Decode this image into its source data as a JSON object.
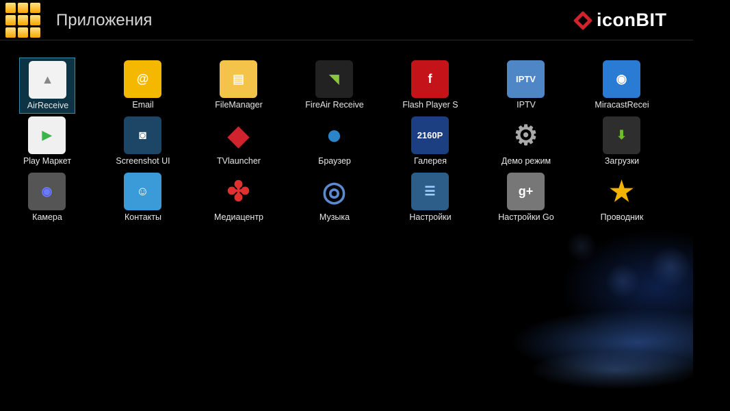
{
  "header": {
    "title": "Приложения",
    "brand": "iconBIT"
  },
  "colors": {
    "accent": "#3a8cab",
    "brand": "#d0232d"
  },
  "apps": [
    {
      "label": "AirReceive",
      "icon": "airplay-icon",
      "glyph": "▲",
      "bg": "#f2f2f2",
      "fg": "#888"
    },
    {
      "label": "Email",
      "icon": "email-icon",
      "glyph": "@",
      "bg": "#f5b800",
      "fg": "#fff"
    },
    {
      "label": "FileManager",
      "icon": "folder-icon",
      "glyph": "▤",
      "bg": "#f3c34a",
      "fg": "#fff7d6"
    },
    {
      "label": "FireAir Receive",
      "icon": "fireair-icon",
      "glyph": "◥",
      "bg": "#222",
      "fg": "#8cc63f"
    },
    {
      "label": "Flash Player S",
      "icon": "flash-icon",
      "glyph": "f",
      "bg": "#c4141a",
      "fg": "#fff"
    },
    {
      "label": "IPTV",
      "icon": "iptv-icon",
      "glyph": "IPTV",
      "bg": "#4f86c6",
      "fg": "#fff"
    },
    {
      "label": "MiracastRecei",
      "icon": "miracast-icon",
      "glyph": "◉",
      "bg": "#2a7bd4",
      "fg": "#fff"
    },
    {
      "label": "Play Маркет",
      "icon": "play-store-icon",
      "glyph": "▶",
      "bg": "#f0f0f0",
      "fg": "#3bb54a"
    },
    {
      "label": "Screenshot UI",
      "icon": "camera-icon",
      "glyph": "◙",
      "bg": "#1d4566",
      "fg": "#fff"
    },
    {
      "label": "TVlauncher",
      "icon": "tvlauncher-icon",
      "glyph": "◆",
      "bg": "transparent",
      "fg": "#d0232d"
    },
    {
      "label": "Браузер",
      "icon": "globe-icon",
      "glyph": "●",
      "bg": "transparent",
      "fg": "#2b86c9"
    },
    {
      "label": "Галерея",
      "icon": "clapper-icon",
      "glyph": "2160P",
      "bg": "#1b3f80",
      "fg": "#fff"
    },
    {
      "label": "Демо режим",
      "icon": "film-gear-icon",
      "glyph": "⚙",
      "bg": "transparent",
      "fg": "#aaa"
    },
    {
      "label": "Загрузки",
      "icon": "download-icon",
      "glyph": "⬇",
      "bg": "#2e2e2e",
      "fg": "#6cbf2a"
    },
    {
      "label": "Камера",
      "icon": "camera-icon",
      "glyph": "◉",
      "bg": "#555",
      "fg": "#6a7bff"
    },
    {
      "label": "Контакты",
      "icon": "contacts-icon",
      "glyph": "☺",
      "bg": "#3a9bd8",
      "fg": "#fff"
    },
    {
      "label": "Медиацентр",
      "icon": "mediacenter-icon",
      "glyph": "✤",
      "bg": "transparent",
      "fg": "#e03030"
    },
    {
      "label": "Музыка",
      "icon": "music-icon",
      "glyph": "◎",
      "bg": "transparent",
      "fg": "#5a8ad0"
    },
    {
      "label": "Настройки",
      "icon": "settings-icon",
      "glyph": "☰",
      "bg": "#2d5e8a",
      "fg": "#9fd0ff"
    },
    {
      "label": "Настройки Go",
      "icon": "google-settings-icon",
      "glyph": "g+",
      "bg": "#777",
      "fg": "#fff"
    },
    {
      "label": "Проводник",
      "icon": "explorer-icon",
      "glyph": "★",
      "bg": "transparent",
      "fg": "#f2b200"
    }
  ]
}
